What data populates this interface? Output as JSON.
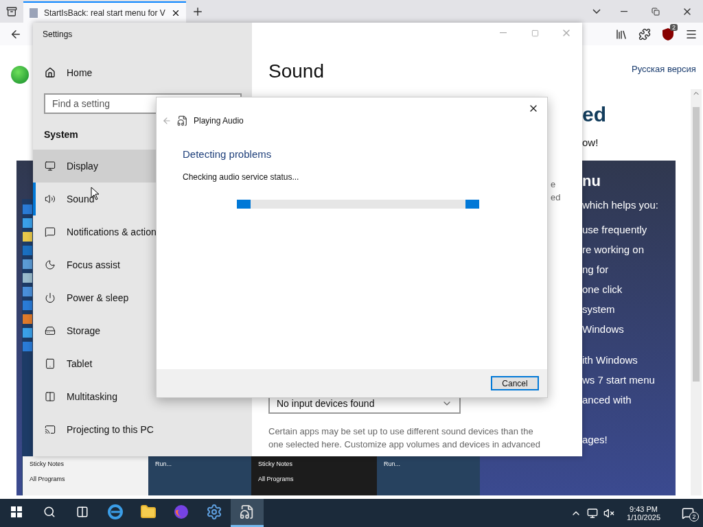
{
  "browser": {
    "tab_title": "StartIsBack: real start menu for V",
    "extension_badge": "2"
  },
  "webpage": {
    "language_link": "Русская версия",
    "heading_fragment": "ed",
    "subheading_fragment": "ow!",
    "banner_title_fragment": "nu",
    "banner_lines": [
      "which helps you:",
      "use frequently",
      "re working on",
      "ng for",
      "one click",
      "system",
      "Windows",
      "ith Windows",
      "ws 7 start menu",
      "anced with",
      "ages!"
    ],
    "screenshot_menus": [
      {
        "kind": "light",
        "items": [
          "Sticky Notes",
          "All Programs"
        ]
      },
      {
        "kind": "tile",
        "items": [
          "Run..."
        ]
      },
      {
        "kind": "dark",
        "items": [
          "Sticky Notes",
          "All Programs"
        ]
      },
      {
        "kind": "tile",
        "items": [
          "Run..."
        ]
      }
    ]
  },
  "settings": {
    "title": "Settings",
    "home": "Home",
    "search_placeholder": "Find a setting",
    "section": "System",
    "nav": [
      {
        "label": "Display",
        "selected": false,
        "hovered": true
      },
      {
        "label": "Sound",
        "selected": true,
        "hovered": false
      },
      {
        "label": "Notifications & action",
        "selected": false,
        "hovered": false
      },
      {
        "label": "Focus assist",
        "selected": false,
        "hovered": false
      },
      {
        "label": "Power & sleep",
        "selected": false,
        "hovered": false
      },
      {
        "label": "Storage",
        "selected": false,
        "hovered": false
      },
      {
        "label": "Tablet",
        "selected": false,
        "hovered": false
      },
      {
        "label": "Multitasking",
        "selected": false,
        "hovered": false
      },
      {
        "label": "Projecting to this PC",
        "selected": false,
        "hovered": false
      }
    ],
    "page_title": "Sound",
    "side_fragments": [
      "e",
      "ed"
    ],
    "input_device": "No input devices found",
    "note_lines": [
      "Certain apps may be set up to use different sound devices than the",
      "one selected here. Customize app volumes and devices in advanced"
    ]
  },
  "dialog": {
    "app": "Playing Audio",
    "heading": "Detecting problems",
    "status": "Checking audio service status...",
    "cancel": "Cancel"
  },
  "taskbar": {
    "apps": [
      {
        "active": false
      },
      {
        "active": false
      },
      {
        "active": false
      },
      {
        "active": false
      },
      {
        "active": true
      }
    ],
    "time": "9:43 PM",
    "date": "1/10/2025",
    "notifications": "2"
  }
}
